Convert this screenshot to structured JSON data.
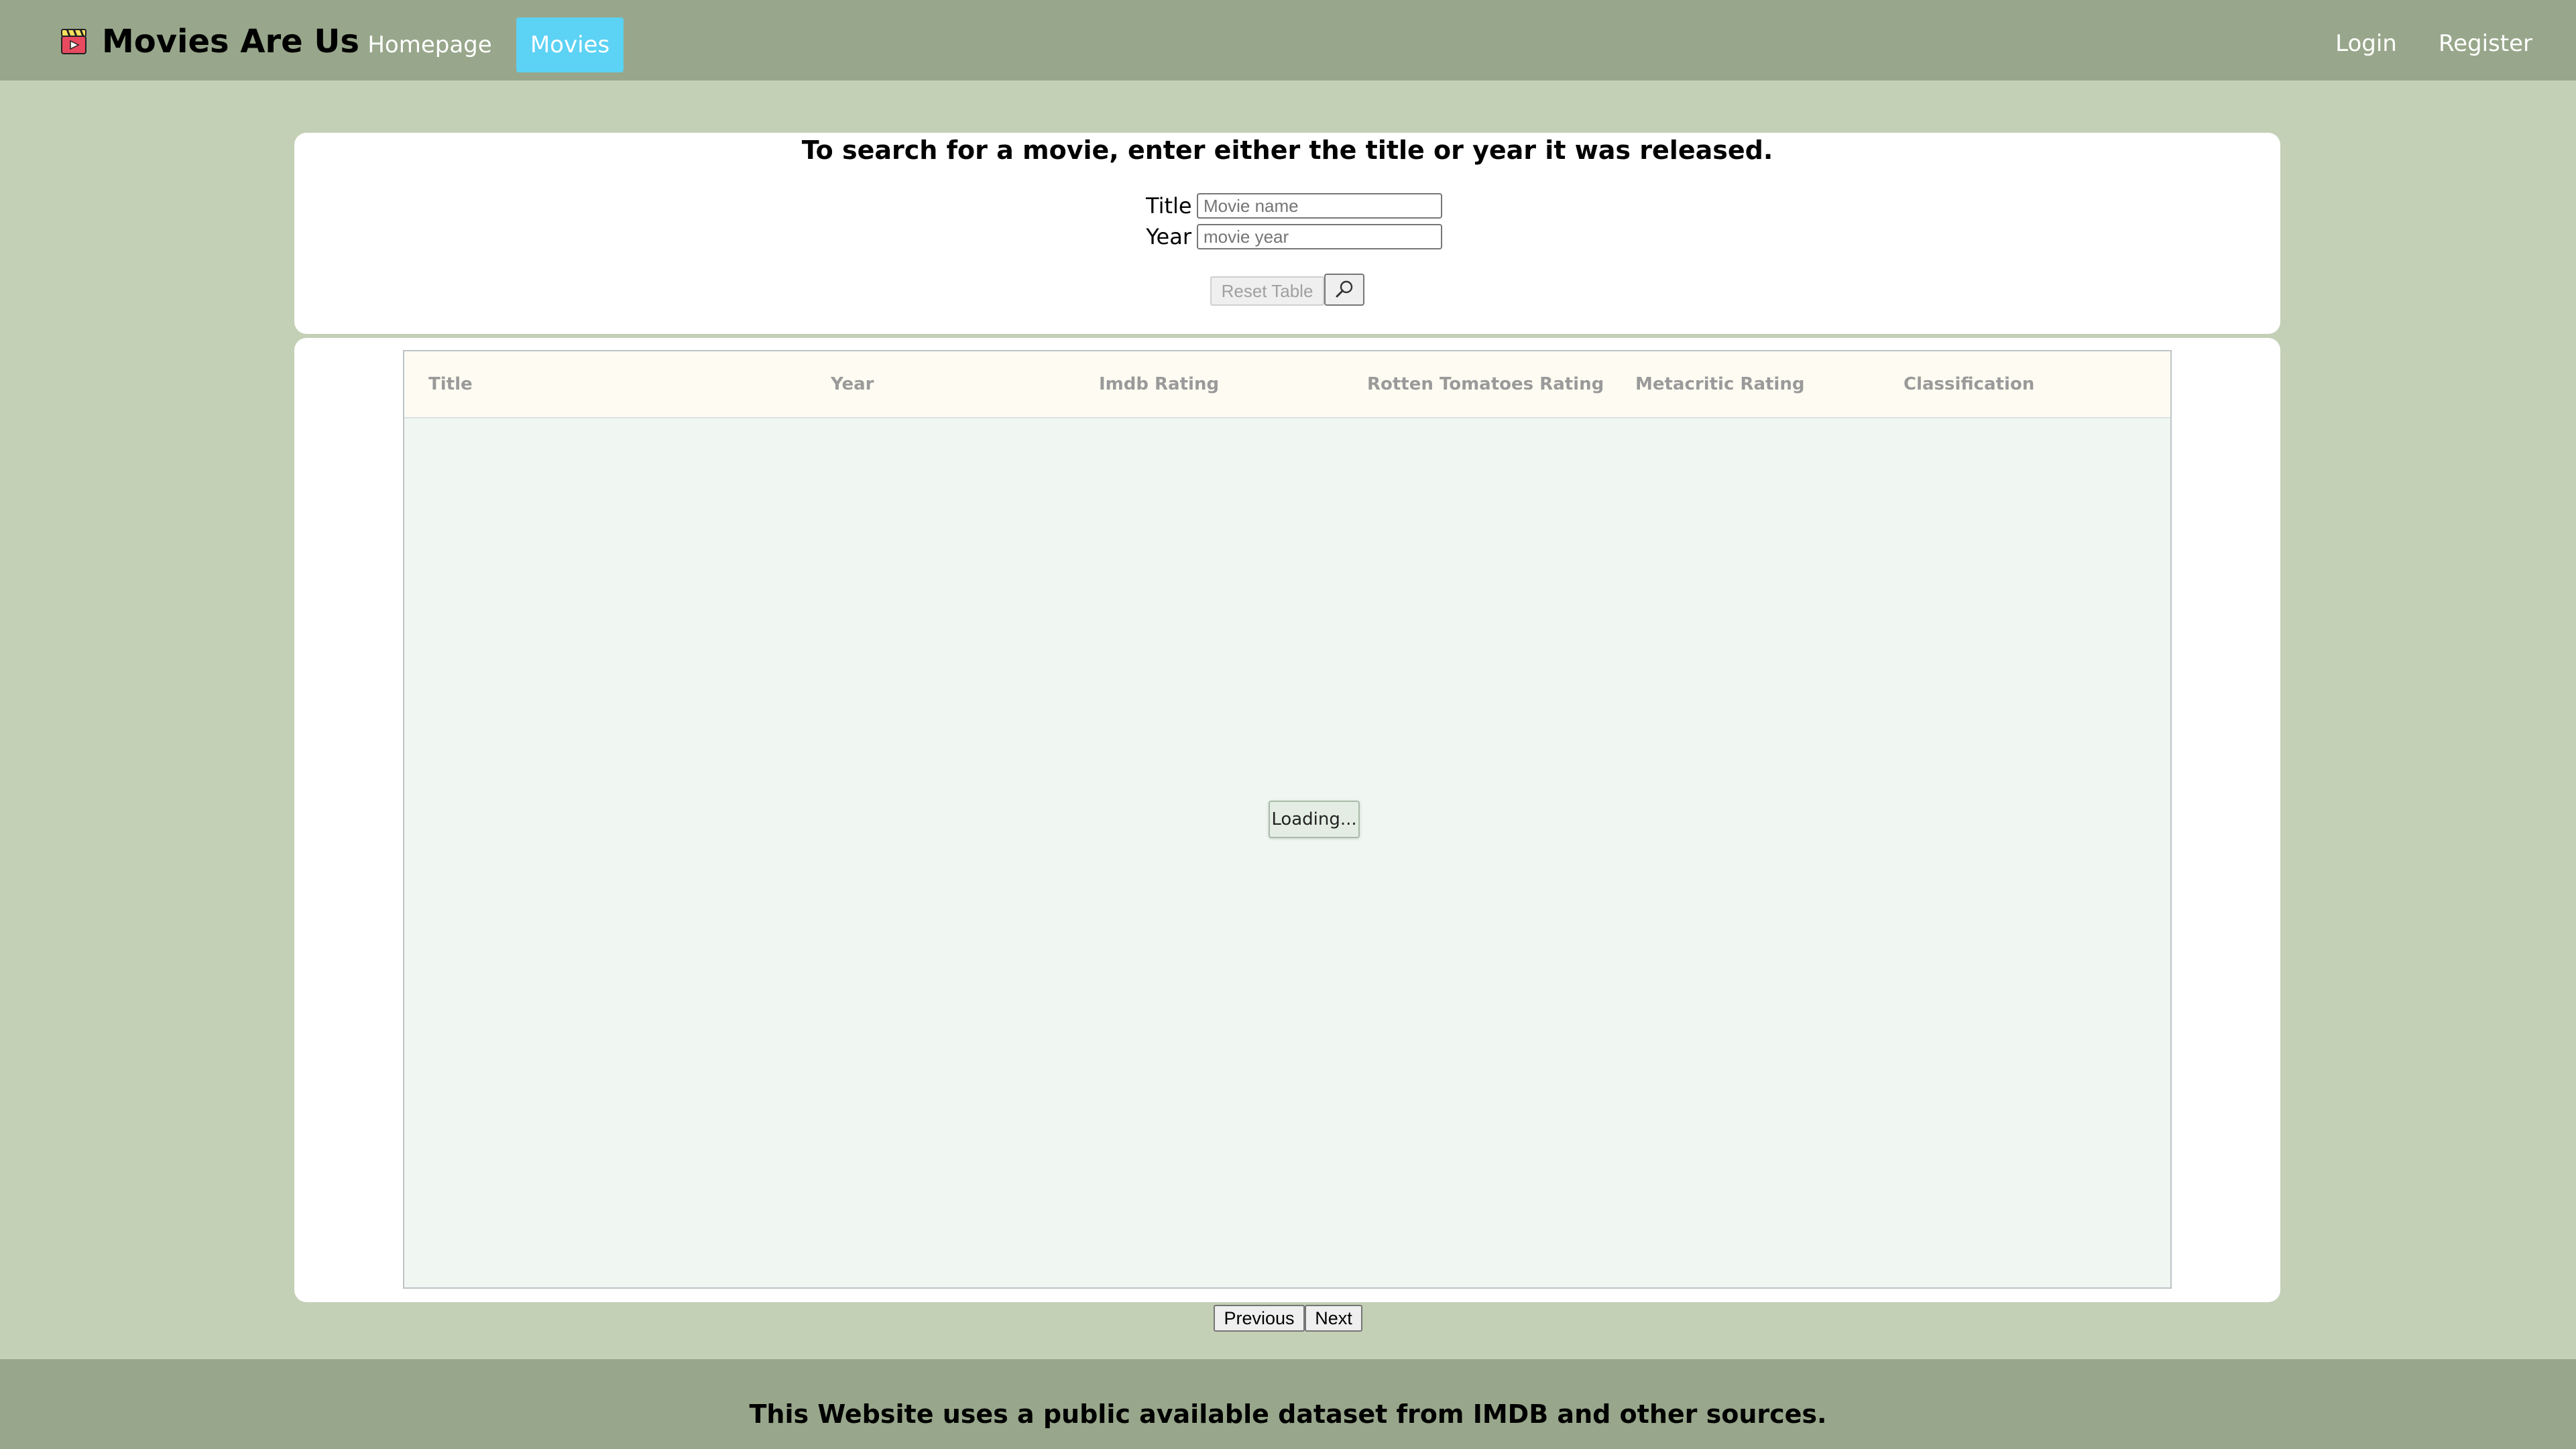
{
  "navbar": {
    "brand": "Movies Are Us",
    "brand_icon": "clapperboard-icon",
    "links": {
      "home": "Homepage",
      "movies": "Movies",
      "login": "Login",
      "register": "Register"
    },
    "active_color": "#5cd2f4",
    "bar_color": "#98a78b"
  },
  "search": {
    "heading": "To search for a movie, enter either the title or year it was released.",
    "title_label": "Title",
    "title_placeholder": "Movie name",
    "title_value": "",
    "year_label": "Year",
    "year_placeholder": "movie year",
    "year_value": "",
    "reset_label": "Reset Table",
    "search_icon": "magnifier-icon"
  },
  "table": {
    "columns": [
      "Title",
      "Year",
      "Imdb Rating",
      "Rotten Tomatoes Rating",
      "Metacritic Rating",
      "Classification"
    ],
    "loading_text": "Loading..."
  },
  "pagination": {
    "previous": "Previous",
    "next": "Next"
  },
  "footer": {
    "text": "This Website uses a public available dataset from IMDB and other sources."
  },
  "colors": {
    "page_background": "#c3d0b6",
    "card_background": "#ffffff",
    "grid_body": "#f0f6f1",
    "grid_header": "#fefcf2"
  }
}
